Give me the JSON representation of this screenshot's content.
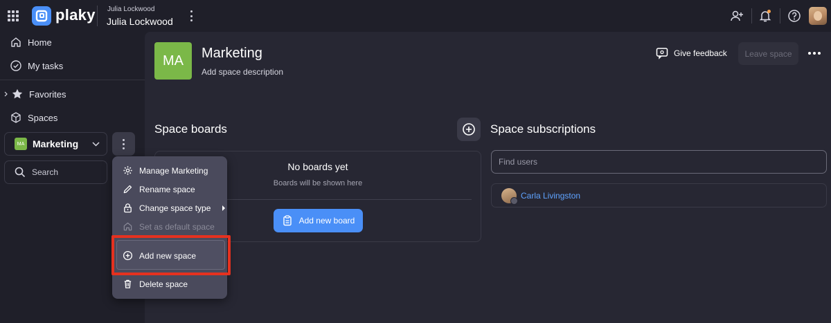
{
  "app": {
    "logo_text": "plaky",
    "brand_color": "#4a8ff7"
  },
  "workspace": {
    "owner_label": "Julia Lockwood",
    "name": "Julia Lockwood"
  },
  "sidebar": {
    "items": [
      {
        "label": "Home",
        "icon": "home-icon"
      },
      {
        "label": "My tasks",
        "icon": "check-circle-icon"
      },
      {
        "label": "Favorites",
        "icon": "star-icon"
      },
      {
        "label": "Spaces",
        "icon": "cube-icon"
      }
    ],
    "space_select": {
      "badge": "MA",
      "label": "Marketing",
      "badge_color": "#7bb848"
    },
    "search_label": "Search"
  },
  "main": {
    "badge": "MA",
    "title": "Marketing",
    "description": "Add space description",
    "feedback_label": "Give feedback",
    "leave_label": "Leave space",
    "boards": {
      "title": "Space boards",
      "empty_title": "No boards yet",
      "empty_hint": "Boards will be shown here",
      "add_label": "Add new board"
    },
    "subscriptions": {
      "title": "Space subscriptions",
      "search_placeholder": "Find users",
      "users": [
        {
          "name": "Carla Livingston"
        }
      ]
    }
  },
  "context_menu": {
    "items": [
      {
        "label": "Manage Marketing",
        "icon": "gear-icon"
      },
      {
        "label": "Rename space",
        "icon": "pencil-icon"
      },
      {
        "label": "Change space type",
        "icon": "lock-icon"
      },
      {
        "label": "Set as default space",
        "icon": "home-icon",
        "disabled": true
      },
      {
        "label": "Add new space",
        "icon": "plus-circle-icon"
      },
      {
        "label": "Delete space",
        "icon": "trash-icon"
      }
    ],
    "highlight_color": "#e5311f"
  }
}
